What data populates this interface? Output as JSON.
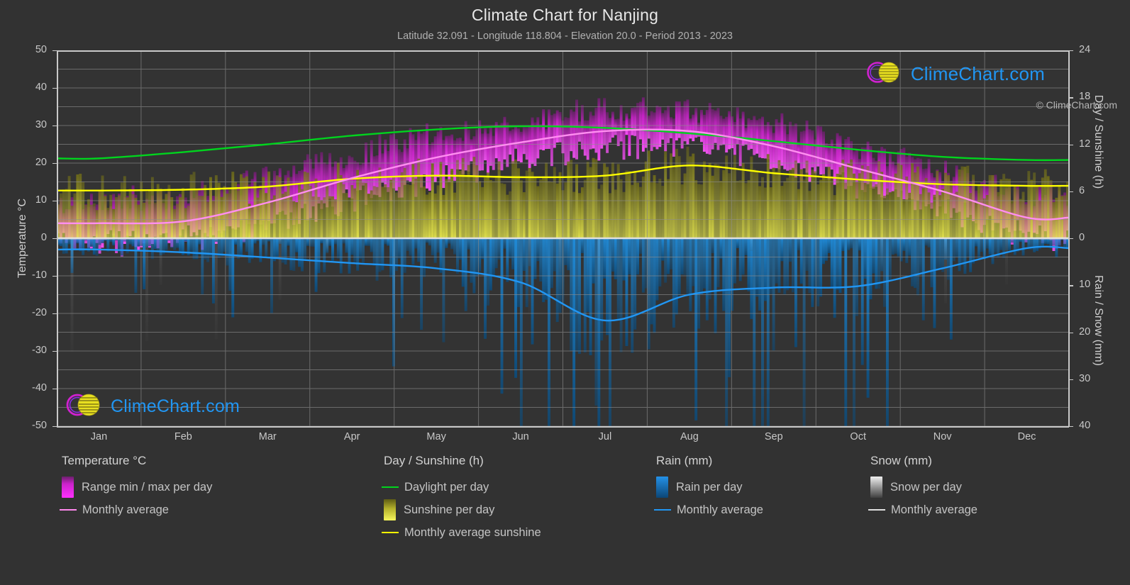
{
  "header": {
    "title": "Climate Chart for Nanjing",
    "subtitle": "Latitude 32.091 - Longitude 118.804 - Elevation 20.0 - Period 2013 - 2023"
  },
  "branding": {
    "name": "ClimeChart.com",
    "copyright": "© ClimeChart.com",
    "accent_blue": "#2196f3",
    "accent_magenta": "#cc22cc",
    "accent_yellow": "#d8d020"
  },
  "axes": {
    "left_title": "Temperature °C",
    "right_title_top": "Day / Sunshine (h)",
    "right_title_bottom": "Rain / Snow (mm)",
    "left_ticks": [
      50,
      40,
      30,
      20,
      10,
      0,
      -10,
      -20,
      -30,
      -40,
      -50
    ],
    "right_ticks_top": [
      24,
      18,
      12,
      6,
      0
    ],
    "right_ticks_bottom": [
      10,
      20,
      30,
      40
    ],
    "x_ticks": [
      "Jan",
      "Feb",
      "Mar",
      "Apr",
      "May",
      "Jun",
      "Jul",
      "Aug",
      "Sep",
      "Oct",
      "Nov",
      "Dec"
    ],
    "temp_range": [
      -50,
      50
    ],
    "sunshine_range": [
      0,
      24
    ],
    "rain_range": [
      0,
      40
    ]
  },
  "legend": {
    "groups": [
      {
        "title": "Temperature °C",
        "items": [
          {
            "label": "Range min / max per day",
            "type": "swatch",
            "color": "#ff00ff"
          },
          {
            "label": "Monthly average",
            "type": "line",
            "color": "#ff88ee"
          }
        ]
      },
      {
        "title": "Day / Sunshine (h)",
        "items": [
          {
            "label": "Daylight per day",
            "type": "line",
            "color": "#00d41e"
          },
          {
            "label": "Sunshine per day",
            "type": "swatch",
            "color": "#f2f24a"
          },
          {
            "label": "Monthly average sunshine",
            "type": "line",
            "color": "#ffff00"
          }
        ]
      },
      {
        "title": "Rain (mm)",
        "items": [
          {
            "label": "Rain per day",
            "type": "swatch",
            "color": "#1787dd"
          },
          {
            "label": "Monthly average",
            "type": "line",
            "color": "#2196f3"
          }
        ]
      },
      {
        "title": "Snow (mm)",
        "items": [
          {
            "label": "Snow per day",
            "type": "swatch",
            "color": "#e8e8e8"
          },
          {
            "label": "Monthly average",
            "type": "line",
            "color": "#e0e0e0"
          }
        ]
      }
    ]
  },
  "chart_data": {
    "type": "line",
    "title": "Climate Chart for Nanjing",
    "subtitle": "Latitude 32.091 - Longitude 118.804 - Elevation 20.0 - Period 2013 - 2023",
    "xlabel": "",
    "ylabel": "Temperature °C",
    "y2label_top": "Day / Sunshine (h)",
    "y2label_bottom": "Rain / Snow (mm)",
    "ylim": [
      -50,
      50
    ],
    "y2lim_top": [
      0,
      24
    ],
    "y2lim_bottom": [
      0,
      40
    ],
    "grid": true,
    "legend_position": "below",
    "categories": [
      "Jan",
      "Feb",
      "Mar",
      "Apr",
      "May",
      "Jun",
      "Jul",
      "Aug",
      "Sep",
      "Oct",
      "Nov",
      "Dec"
    ],
    "series": [
      {
        "name": "Monthly average temperature (°C)",
        "color": "#ff88ee",
        "axis": "left",
        "unit": "°C",
        "values": [
          4.0,
          4.5,
          9.5,
          16.0,
          21.5,
          25.5,
          28.5,
          28.5,
          24.5,
          18.5,
          12.5,
          5.5
        ]
      },
      {
        "name": "Daily max temperature range top (°C)",
        "color": "#ff00ff",
        "axis": "left",
        "unit": "°C",
        "values": [
          9.0,
          10.5,
          15.5,
          22.0,
          27.0,
          30.5,
          33.5,
          33.5,
          29.5,
          24.0,
          18.0,
          11.0
        ]
      },
      {
        "name": "Daily min temperature range bottom (°C)",
        "color": "#ff00ff",
        "axis": "left",
        "unit": "°C",
        "values": [
          0.0,
          0.5,
          4.5,
          10.5,
          16.0,
          21.0,
          25.0,
          25.0,
          20.5,
          14.0,
          8.0,
          1.5
        ]
      },
      {
        "name": "Daylight per day (h)",
        "color": "#00d41e",
        "axis": "right_top",
        "unit": "h",
        "values": [
          10.2,
          11.0,
          12.0,
          13.1,
          13.9,
          14.3,
          14.1,
          13.4,
          12.4,
          11.3,
          10.4,
          10.0
        ]
      },
      {
        "name": "Monthly average sunshine (h)",
        "color": "#ffff00",
        "axis": "right_top",
        "unit": "h",
        "values": [
          6.1,
          6.2,
          6.6,
          7.6,
          8.0,
          7.8,
          8.0,
          9.3,
          8.3,
          7.5,
          6.9,
          6.7
        ]
      },
      {
        "name": "Monthly average rain (mm)",
        "color": "#2196f3",
        "axis": "right_bottom",
        "unit": "mm",
        "values": [
          2.4,
          3.0,
          4.1,
          5.3,
          6.4,
          9.4,
          17.5,
          12.0,
          10.5,
          10.2,
          6.4,
          2.1
        ]
      },
      {
        "name": "Monthly average snow (mm)",
        "color": "#e0e0e0",
        "axis": "right_bottom",
        "unit": "mm",
        "values": [
          0.1,
          0.1,
          0.0,
          0.0,
          0.0,
          0.0,
          0.0,
          0.0,
          0.0,
          0.0,
          0.0,
          0.1
        ]
      }
    ]
  }
}
